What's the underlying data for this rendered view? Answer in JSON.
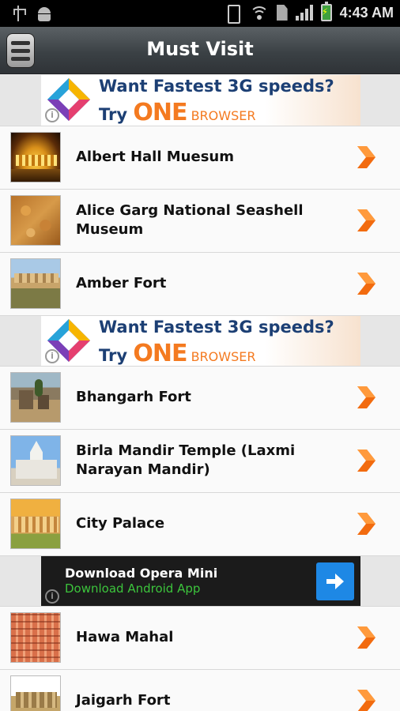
{
  "status_bar": {
    "left_icons": [
      "usb-icon",
      "android-debug-icon"
    ],
    "right_icons": [
      "vibrate-icon",
      "wifi-icon",
      "sim-icon",
      "signal-icon",
      "battery-charging-icon"
    ],
    "time": "4:43 AM"
  },
  "header": {
    "title": "Must Visit",
    "menu_icon": "hamburger-menu-icon"
  },
  "ads": {
    "one_browser": {
      "line1": "Want Fastest 3G speeds?",
      "try": "Try ",
      "brand": "ONE",
      "browser": " BROWSER",
      "info": "i"
    },
    "opera": {
      "title": "Download Opera Mini",
      "subtitle": "Download Android App",
      "info": "i",
      "button_icon": "arrow-right-icon",
      "button_color": "#1e88e5"
    }
  },
  "places": [
    {
      "name": "Albert Hall Muesum",
      "thumb": "night-palace"
    },
    {
      "name": "Alice Garg National Seashell Museum",
      "thumb": "seashells"
    },
    {
      "name": "Amber Fort",
      "thumb": "fort-hill"
    },
    {
      "name": "Bhangarh Fort",
      "thumb": "ruins"
    },
    {
      "name": "Birla Mandir Temple (Laxmi Narayan Mandir)",
      "thumb": "white-temple"
    },
    {
      "name": "City Palace",
      "thumb": "palace-courtyard"
    },
    {
      "name": "Hawa Mahal",
      "thumb": "pink-facade"
    },
    {
      "name": "Jaigarh Fort",
      "thumb": "fort-walls"
    }
  ],
  "accent_color": "#f47a20"
}
